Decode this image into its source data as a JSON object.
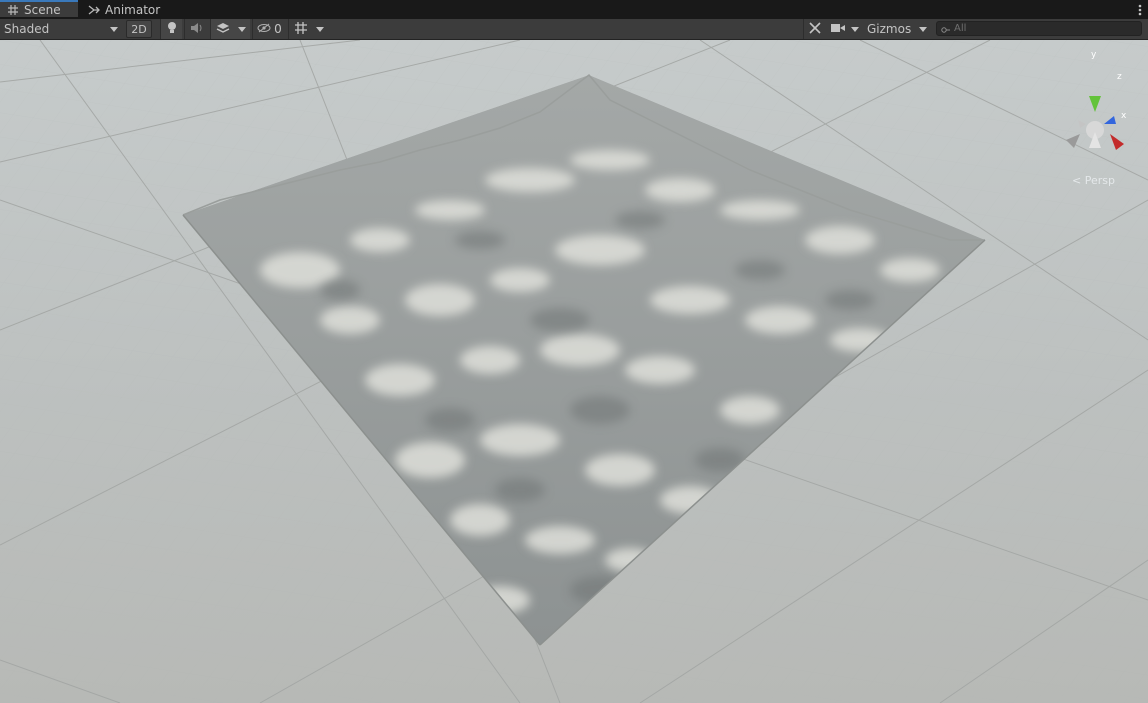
{
  "tabs": [
    {
      "label": "Scene",
      "icon": "scene-grid-icon",
      "active": true
    },
    {
      "label": "Animator",
      "icon": "animator-icon",
      "active": false
    }
  ],
  "toolbar": {
    "shading_mode": "Shaded",
    "toggle_2d": "2D",
    "hidden_count": "0",
    "gizmos": "Gizmos",
    "search_placeholder": "All"
  },
  "gizmo": {
    "axis_y": "y",
    "axis_z": "z",
    "axis_x": "x",
    "projection": "< Persp"
  },
  "colors": {
    "panel": "#3c3c3c",
    "tabbar": "#191919",
    "sky": "#c3c8c9",
    "ground": "#b9bcba",
    "axis_x": "#c32b2b",
    "axis_y": "#63c33a",
    "axis_z": "#3366dd"
  }
}
